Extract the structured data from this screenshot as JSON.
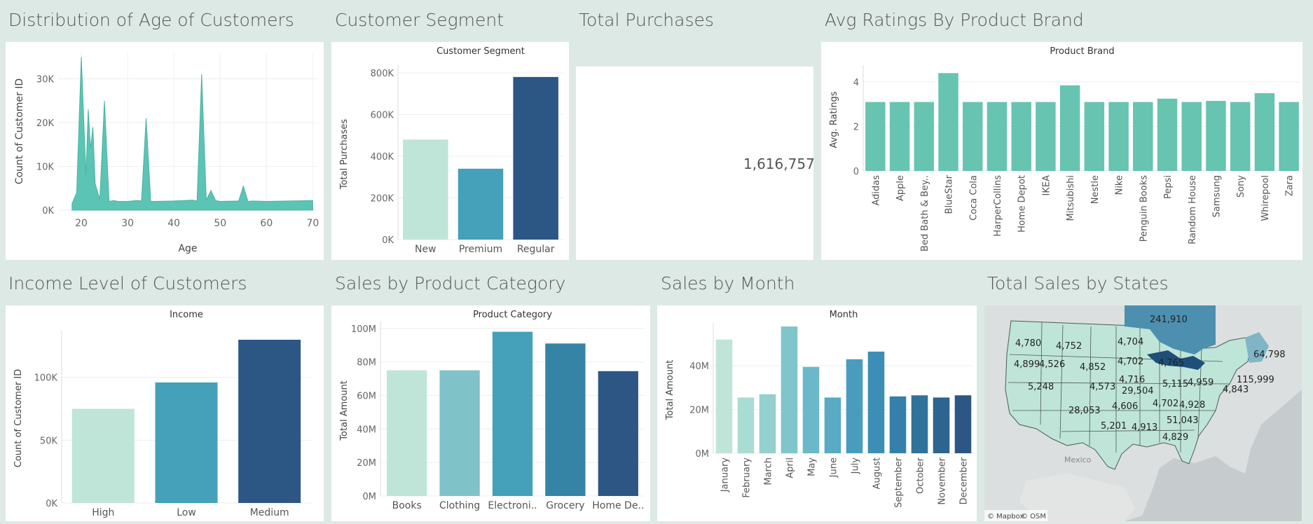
{
  "titles": {
    "age": "Distribution of  Age of Customers",
    "segment": "Customer Segment",
    "total_purchases": "Total Purchases",
    "ratings": "Avg Ratings By Product Brand",
    "income": "Income Level of Customers",
    "category": "Sales by Product  Category",
    "month": "Sales by Month",
    "states": "Total Sales by States"
  },
  "colors": {
    "background": "#dde9e5",
    "teal_area": "#5cc4b4",
    "teal_bar": "#66c4b0",
    "pale": "#bfe5d8",
    "mid": "#45a0b9",
    "dark": "#2c5784"
  },
  "total_purchases": {
    "value": "1,616,757"
  },
  "map": {
    "attribution_mapbox": "© Mapbox",
    "attribution_osm": "© OSM",
    "country_label": "Mexico",
    "state_labels": [
      "241,910",
      "4,780",
      "4,752",
      "4,704",
      "64,798",
      "4,899",
      "4,526",
      "4,852",
      "4,702",
      "4,765",
      "115,999",
      "4,716",
      "5,248",
      "4,573",
      "5,115",
      "4,959",
      "4,843",
      "29,504",
      "4,606",
      "4,702",
      "4,928",
      "28,053",
      "51,043",
      "5,201",
      "4,913",
      "4,829"
    ]
  },
  "chart_data": [
    {
      "id": "age",
      "type": "area",
      "title": "",
      "xlabel": "Age",
      "ylabel": "Count of Customer ID",
      "xlim": [
        15,
        71
      ],
      "ylim": [
        0,
        36000
      ],
      "xticks": [
        "20",
        "30",
        "40",
        "50",
        "60",
        "70"
      ],
      "yticks": [
        "0K",
        "10K",
        "20K",
        "30K"
      ],
      "x": [
        18,
        19,
        20,
        21,
        21.5,
        22,
        22.5,
        23,
        24,
        25,
        26,
        27,
        28,
        30,
        32,
        33,
        34,
        35,
        36,
        40,
        44,
        45,
        46,
        47,
        48,
        49,
        50,
        54,
        55,
        56,
        57,
        60,
        65,
        70
      ],
      "y": [
        1500,
        4000,
        35000,
        8000,
        23000,
        14000,
        19000,
        6000,
        2500,
        25000,
        2000,
        2200,
        2000,
        2000,
        2200,
        2100,
        21000,
        2000,
        2000,
        2100,
        2300,
        2100,
        31000,
        2300,
        4500,
        2200,
        2000,
        2100,
        5500,
        2000,
        2100,
        2000,
        2100,
        2200
      ]
    },
    {
      "id": "segment",
      "type": "bar",
      "title": "Customer Segment",
      "xlabel": "",
      "ylabel": "Total Purchases",
      "categories": [
        "New",
        "Premium",
        "Regular"
      ],
      "values": [
        480000,
        340000,
        780000
      ],
      "ylim": [
        0,
        820000
      ],
      "yticks": [
        "0K",
        "200K",
        "400K",
        "600K",
        "800K"
      ],
      "colors": [
        "#bfe5d8",
        "#45a0b9",
        "#2c5784"
      ]
    },
    {
      "id": "ratings",
      "type": "bar",
      "title": "Product Brand",
      "xlabel": "",
      "ylabel": "Avg. Ratings",
      "categories": [
        "Adidas",
        "Apple",
        "Bed Bath & Bey..",
        "BlueStar",
        "Coca Cola",
        "HarperCollins",
        "Home Depot",
        "IKEA",
        "Mitsubishi",
        "Nestle",
        "Nike",
        "Penguin Books",
        "Pepsi",
        "Random House",
        "Samsung",
        "Sony",
        "Whirepool",
        "Zara"
      ],
      "values": [
        3.1,
        3.1,
        3.1,
        4.4,
        3.1,
        3.1,
        3.1,
        3.1,
        3.85,
        3.1,
        3.1,
        3.1,
        3.25,
        3.1,
        3.15,
        3.1,
        3.5,
        3.1
      ],
      "ylim": [
        0,
        4.6
      ],
      "yticks": [
        "0",
        "2",
        "4"
      ]
    },
    {
      "id": "income",
      "type": "bar",
      "title": "Income",
      "xlabel": "",
      "ylabel": "Count of Customer ID",
      "categories": [
        "High",
        "Low",
        "Medium"
      ],
      "values": [
        75000,
        96000,
        130000
      ],
      "ylim": [
        0,
        135000
      ],
      "yticks": [
        "0K",
        "50K",
        "100K"
      ],
      "colors": [
        "#bfe5d8",
        "#45a0b9",
        "#2c5784"
      ]
    },
    {
      "id": "category",
      "type": "bar",
      "title": "Product Category",
      "xlabel": "",
      "ylabel": "Total Amount",
      "categories": [
        "Books",
        "Clothing",
        "Electroni..",
        "Grocery",
        "Home De.."
      ],
      "values": [
        75000000,
        75000000,
        98000000,
        91000000,
        74500000
      ],
      "ylim": [
        0,
        102000000
      ],
      "yticks": [
        "0M",
        "20M",
        "40M",
        "60M",
        "80M",
        "100M"
      ],
      "colors": [
        "#bfe5d8",
        "#7fc3c8",
        "#45a0b9",
        "#3584a5",
        "#2c5784"
      ]
    },
    {
      "id": "month",
      "type": "bar",
      "title": "Month",
      "xlabel": "",
      "ylabel": "Total Amount",
      "categories": [
        "January",
        "February",
        "March",
        "April",
        "May",
        "June",
        "July",
        "August",
        "September",
        "October",
        "November",
        "December"
      ],
      "values": [
        52000000,
        25500000,
        27000000,
        58000000,
        39500000,
        25500000,
        43000000,
        46500000,
        26000000,
        26500000,
        25500000,
        26500000
      ],
      "ylim": [
        0,
        58000000
      ],
      "yticks": [
        "0M",
        "20M",
        "40M"
      ],
      "colors": [
        "#bfe5d8",
        "#a9dcd3",
        "#94d0ce",
        "#80c5cb",
        "#6bb8c8",
        "#59aac2",
        "#4a9cbd",
        "#3d8eb5",
        "#3580aa",
        "#30729c",
        "#2e658f",
        "#2c5784"
      ]
    }
  ]
}
